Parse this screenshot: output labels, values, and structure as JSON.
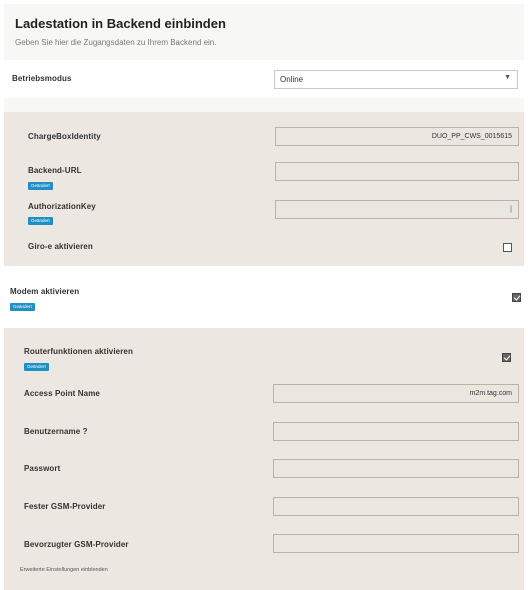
{
  "backend": {
    "title": "Ladestation in Backend einbinden",
    "subtitle": "Geben Sie hier die Zugangsdaten zu Ihrem Backend ein.",
    "mode_label": "Betriebsmodus",
    "mode_value": "Online",
    "fields": {
      "chargebox_label": "ChargeBoxIdentity",
      "chargebox_value": "DUO_PP_CWS_0015615",
      "url_label": "Backend-URL",
      "url_badge": "Geändert",
      "url_value": "",
      "auth_label": "AuthorizationKey",
      "auth_badge": "Geändert",
      "auth_value": "|",
      "giro_label": "Giro-e aktivieren"
    }
  },
  "modem": {
    "label": "Modem aktivieren",
    "badge": "Geändert",
    "router_label": "Routerfunktionen aktivieren",
    "router_badge": "Geändert",
    "apn_label": "Access Point Name",
    "apn_value": "m2m.tag.com",
    "user_label": "Benutzername ?",
    "user_value": "",
    "password_label": "Passwort",
    "password_value": "",
    "fixed_gsm_label": "Fester GSM-Provider",
    "fixed_gsm_value": "",
    "preferred_gsm_label": "Bevorzugter GSM-Provider",
    "preferred_gsm_value": "",
    "advanced_link": "Erweiterte Einstellungen einblenden"
  }
}
